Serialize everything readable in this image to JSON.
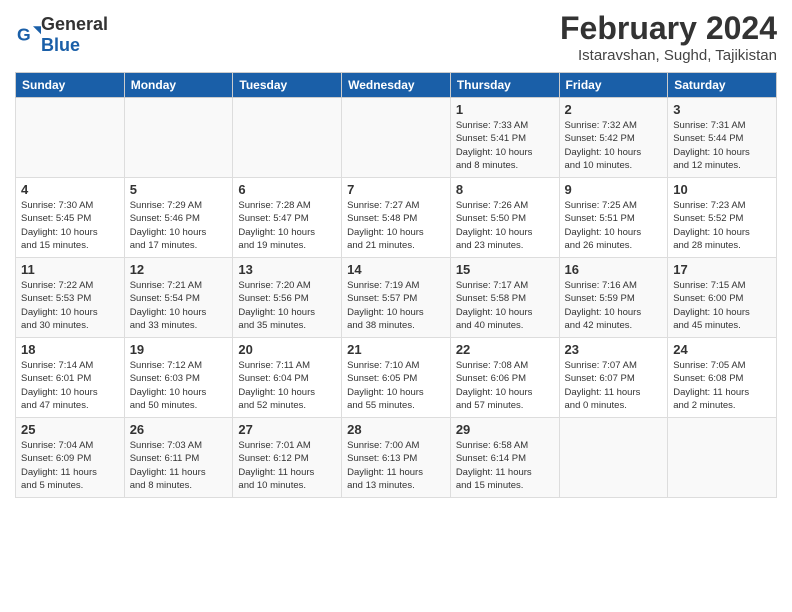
{
  "logo": {
    "general": "General",
    "blue": "Blue"
  },
  "title": "February 2024",
  "subtitle": "Istaravshan, Sughd, Tajikistan",
  "headers": [
    "Sunday",
    "Monday",
    "Tuesday",
    "Wednesday",
    "Thursday",
    "Friday",
    "Saturday"
  ],
  "weeks": [
    [
      {
        "day": "",
        "info": ""
      },
      {
        "day": "",
        "info": ""
      },
      {
        "day": "",
        "info": ""
      },
      {
        "day": "",
        "info": ""
      },
      {
        "day": "1",
        "info": "Sunrise: 7:33 AM\nSunset: 5:41 PM\nDaylight: 10 hours\nand 8 minutes."
      },
      {
        "day": "2",
        "info": "Sunrise: 7:32 AM\nSunset: 5:42 PM\nDaylight: 10 hours\nand 10 minutes."
      },
      {
        "day": "3",
        "info": "Sunrise: 7:31 AM\nSunset: 5:44 PM\nDaylight: 10 hours\nand 12 minutes."
      }
    ],
    [
      {
        "day": "4",
        "info": "Sunrise: 7:30 AM\nSunset: 5:45 PM\nDaylight: 10 hours\nand 15 minutes."
      },
      {
        "day": "5",
        "info": "Sunrise: 7:29 AM\nSunset: 5:46 PM\nDaylight: 10 hours\nand 17 minutes."
      },
      {
        "day": "6",
        "info": "Sunrise: 7:28 AM\nSunset: 5:47 PM\nDaylight: 10 hours\nand 19 minutes."
      },
      {
        "day": "7",
        "info": "Sunrise: 7:27 AM\nSunset: 5:48 PM\nDaylight: 10 hours\nand 21 minutes."
      },
      {
        "day": "8",
        "info": "Sunrise: 7:26 AM\nSunset: 5:50 PM\nDaylight: 10 hours\nand 23 minutes."
      },
      {
        "day": "9",
        "info": "Sunrise: 7:25 AM\nSunset: 5:51 PM\nDaylight: 10 hours\nand 26 minutes."
      },
      {
        "day": "10",
        "info": "Sunrise: 7:23 AM\nSunset: 5:52 PM\nDaylight: 10 hours\nand 28 minutes."
      }
    ],
    [
      {
        "day": "11",
        "info": "Sunrise: 7:22 AM\nSunset: 5:53 PM\nDaylight: 10 hours\nand 30 minutes."
      },
      {
        "day": "12",
        "info": "Sunrise: 7:21 AM\nSunset: 5:54 PM\nDaylight: 10 hours\nand 33 minutes."
      },
      {
        "day": "13",
        "info": "Sunrise: 7:20 AM\nSunset: 5:56 PM\nDaylight: 10 hours\nand 35 minutes."
      },
      {
        "day": "14",
        "info": "Sunrise: 7:19 AM\nSunset: 5:57 PM\nDaylight: 10 hours\nand 38 minutes."
      },
      {
        "day": "15",
        "info": "Sunrise: 7:17 AM\nSunset: 5:58 PM\nDaylight: 10 hours\nand 40 minutes."
      },
      {
        "day": "16",
        "info": "Sunrise: 7:16 AM\nSunset: 5:59 PM\nDaylight: 10 hours\nand 42 minutes."
      },
      {
        "day": "17",
        "info": "Sunrise: 7:15 AM\nSunset: 6:00 PM\nDaylight: 10 hours\nand 45 minutes."
      }
    ],
    [
      {
        "day": "18",
        "info": "Sunrise: 7:14 AM\nSunset: 6:01 PM\nDaylight: 10 hours\nand 47 minutes."
      },
      {
        "day": "19",
        "info": "Sunrise: 7:12 AM\nSunset: 6:03 PM\nDaylight: 10 hours\nand 50 minutes."
      },
      {
        "day": "20",
        "info": "Sunrise: 7:11 AM\nSunset: 6:04 PM\nDaylight: 10 hours\nand 52 minutes."
      },
      {
        "day": "21",
        "info": "Sunrise: 7:10 AM\nSunset: 6:05 PM\nDaylight: 10 hours\nand 55 minutes."
      },
      {
        "day": "22",
        "info": "Sunrise: 7:08 AM\nSunset: 6:06 PM\nDaylight: 10 hours\nand 57 minutes."
      },
      {
        "day": "23",
        "info": "Sunrise: 7:07 AM\nSunset: 6:07 PM\nDaylight: 11 hours\nand 0 minutes."
      },
      {
        "day": "24",
        "info": "Sunrise: 7:05 AM\nSunset: 6:08 PM\nDaylight: 11 hours\nand 2 minutes."
      }
    ],
    [
      {
        "day": "25",
        "info": "Sunrise: 7:04 AM\nSunset: 6:09 PM\nDaylight: 11 hours\nand 5 minutes."
      },
      {
        "day": "26",
        "info": "Sunrise: 7:03 AM\nSunset: 6:11 PM\nDaylight: 11 hours\nand 8 minutes."
      },
      {
        "day": "27",
        "info": "Sunrise: 7:01 AM\nSunset: 6:12 PM\nDaylight: 11 hours\nand 10 minutes."
      },
      {
        "day": "28",
        "info": "Sunrise: 7:00 AM\nSunset: 6:13 PM\nDaylight: 11 hours\nand 13 minutes."
      },
      {
        "day": "29",
        "info": "Sunrise: 6:58 AM\nSunset: 6:14 PM\nDaylight: 11 hours\nand 15 minutes."
      },
      {
        "day": "",
        "info": ""
      },
      {
        "day": "",
        "info": ""
      }
    ]
  ]
}
